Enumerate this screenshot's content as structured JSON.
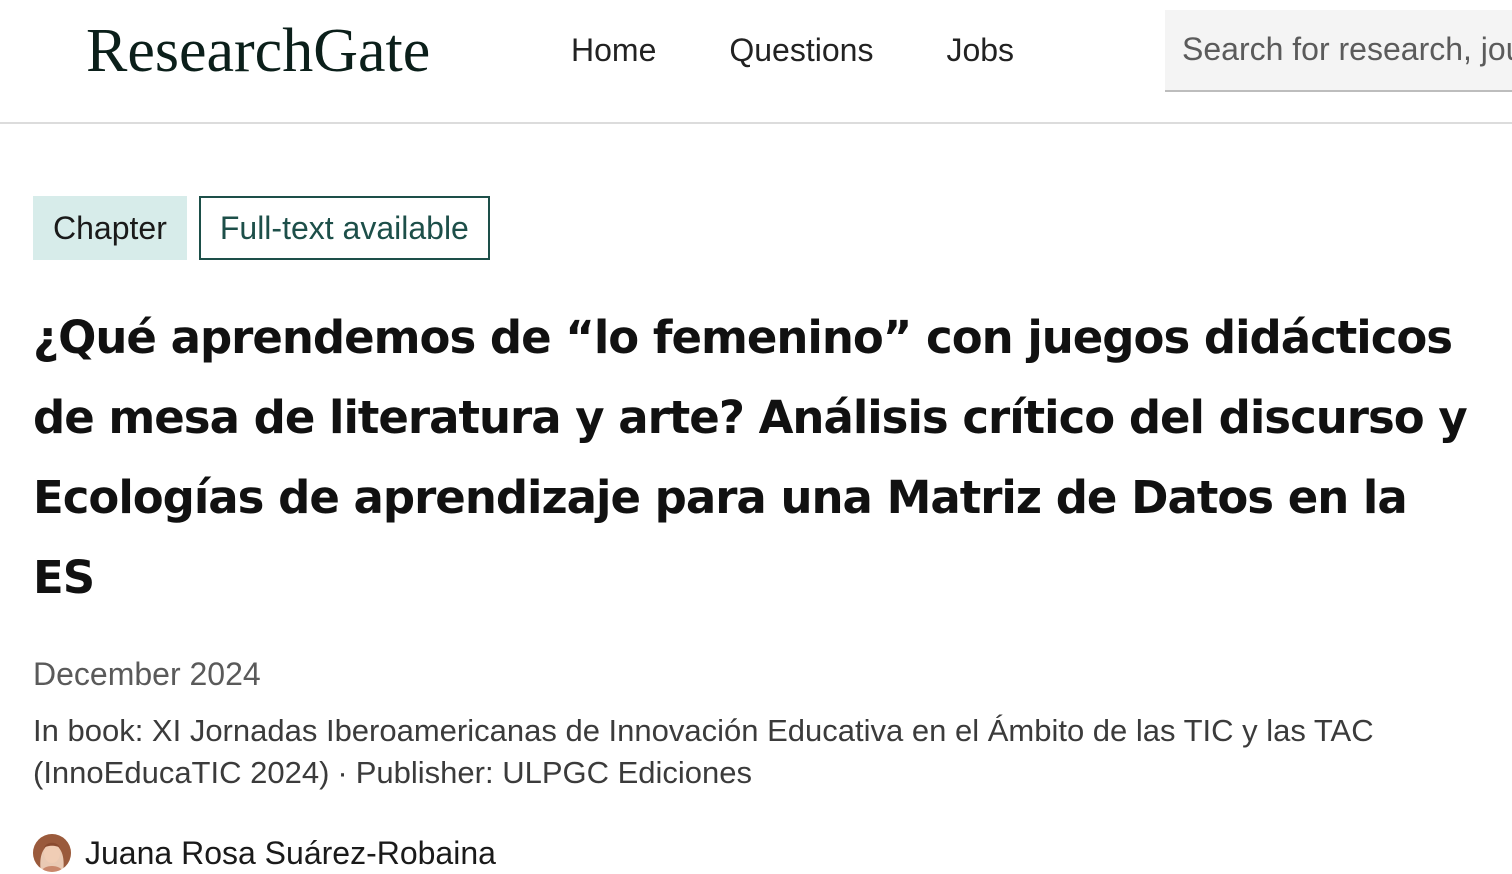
{
  "header": {
    "logo_text": "ResearchGate",
    "nav": [
      {
        "label": "Home"
      },
      {
        "label": "Questions"
      },
      {
        "label": "Jobs"
      }
    ],
    "search": {
      "placeholder": "Search for research, journals, people, etc."
    }
  },
  "publication": {
    "type_badge": "Chapter",
    "availability_badge": "Full-text available",
    "title": "¿Qué aprendemos de “lo femenino” con juegos didácticos de mesa de literatura y arte? Análisis crítico del discurso y Ecologías de aprendizaje para una Matriz de Datos en la ES",
    "date": "December 2024",
    "book_label": "In book: XI Jornadas Iberoamericanas de Innovación Educativa en el Ámbito de las TIC y las TAC (InnoEducaTIC 2024)",
    "separator": "·",
    "publisher_label": "Publisher: ULPGC Ediciones",
    "author": {
      "name": "Juana Rosa Suárez-Robaina",
      "avatar_icon": "author-avatar-photo"
    }
  },
  "colors": {
    "badge_chapter_bg": "#d7ecea",
    "badge_fulltext_border": "#1d4f49",
    "logo": "#0b1f1a"
  }
}
